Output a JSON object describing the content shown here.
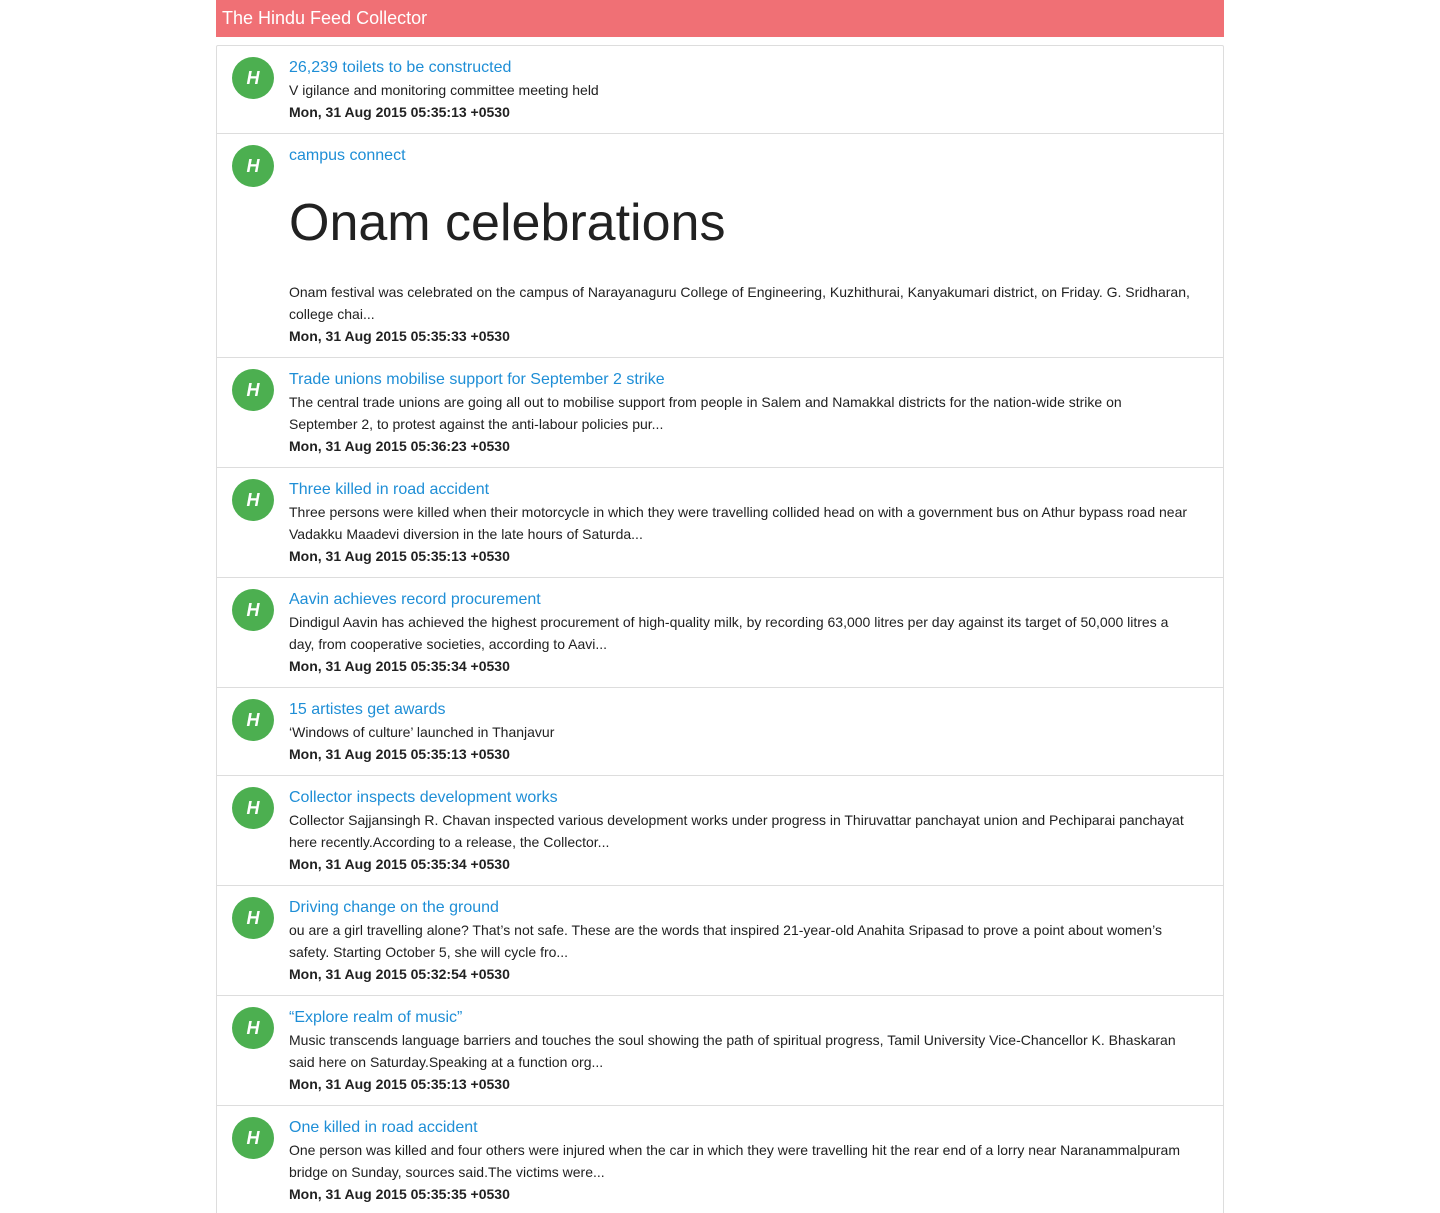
{
  "app": {
    "title": "The Hindu Feed Collector"
  },
  "colors": {
    "header": "#f07075",
    "avatar": "#4caf50",
    "link": "#1e8ed6"
  },
  "feed": [
    {
      "avatar": "H",
      "title": "26,239 toilets to be constructed",
      "heading": "",
      "description": "V igilance and monitoring committee meeting held",
      "date": "Mon, 31 Aug 2015 05:35:13 +0530"
    },
    {
      "avatar": "H",
      "title": "campus connect",
      "heading": "Onam celebrations",
      "description": "Onam festival was celebrated on the campus of Narayanaguru College of Engineering, Kuzhithurai, Kanyakumari district, on Friday. G. Sridharan, college chai...",
      "date": "Mon, 31 Aug 2015 05:35:33 +0530"
    },
    {
      "avatar": "H",
      "title": "Trade unions mobilise support for September 2 strike",
      "heading": "",
      "description": "The central trade unions are going all out to mobilise support from people in Salem and Namakkal districts for the nation-wide strike on September 2, to protest against the anti-labour policies pur...",
      "date": "Mon, 31 Aug 2015 05:36:23 +0530"
    },
    {
      "avatar": "H",
      "title": "Three killed in road accident",
      "heading": "",
      "description": "Three persons were killed when their motorcycle in which they were travelling collided head on with a government bus on Athur bypass road near Vadakku Maadevi diversion in the late hours of Saturda...",
      "date": "Mon, 31 Aug 2015 05:35:13 +0530"
    },
    {
      "avatar": "H",
      "title": "Aavin achieves record procurement",
      "heading": "",
      "description": "Dindigul Aavin has achieved the highest procurement of high-quality milk, by recording 63,000 litres per day against its target of 50,000 litres a day, from cooperative societies, according to Aavi...",
      "date": "Mon, 31 Aug 2015 05:35:34 +0530"
    },
    {
      "avatar": "H",
      "title": "15 artistes get awards",
      "heading": "",
      "description": "‘Windows of culture’ launched in Thanjavur",
      "date": "Mon, 31 Aug 2015 05:35:13 +0530"
    },
    {
      "avatar": "H",
      "title": "Collector inspects development works",
      "heading": "",
      "description": "Collector Sajjansingh R. Chavan inspected various development works under progress in Thiruvattar panchayat union and Pechiparai panchayat here recently.According to a release, the Collector...",
      "date": "Mon, 31 Aug 2015 05:35:34 +0530"
    },
    {
      "avatar": "H",
      "title": "Driving change on the ground",
      "heading": "",
      "description": "ou are a girl travelling alone? That’s not safe. These are the words that inspired 21-year-old Anahita Sripasad to prove a point about women’s safety. Starting October 5, she will cycle fro...",
      "date": "Mon, 31 Aug 2015 05:32:54 +0530"
    },
    {
      "avatar": "H",
      "title": "“Explore realm of music”",
      "heading": "",
      "description": "Music transcends language barriers and touches the soul showing the path of spiritual progress, Tamil University Vice-Chancellor K. Bhaskaran said here on Saturday.Speaking at a function org...",
      "date": "Mon, 31 Aug 2015 05:35:13 +0530"
    },
    {
      "avatar": "H",
      "title": "One killed in road accident",
      "heading": "",
      "description": "One person was killed and four others were injured when the car in which they were travelling hit the rear end of a lorry near Naranammalpuram bridge on Sunday, sources said.The victims were...",
      "date": "Mon, 31 Aug 2015 05:35:35 +0530"
    }
  ]
}
